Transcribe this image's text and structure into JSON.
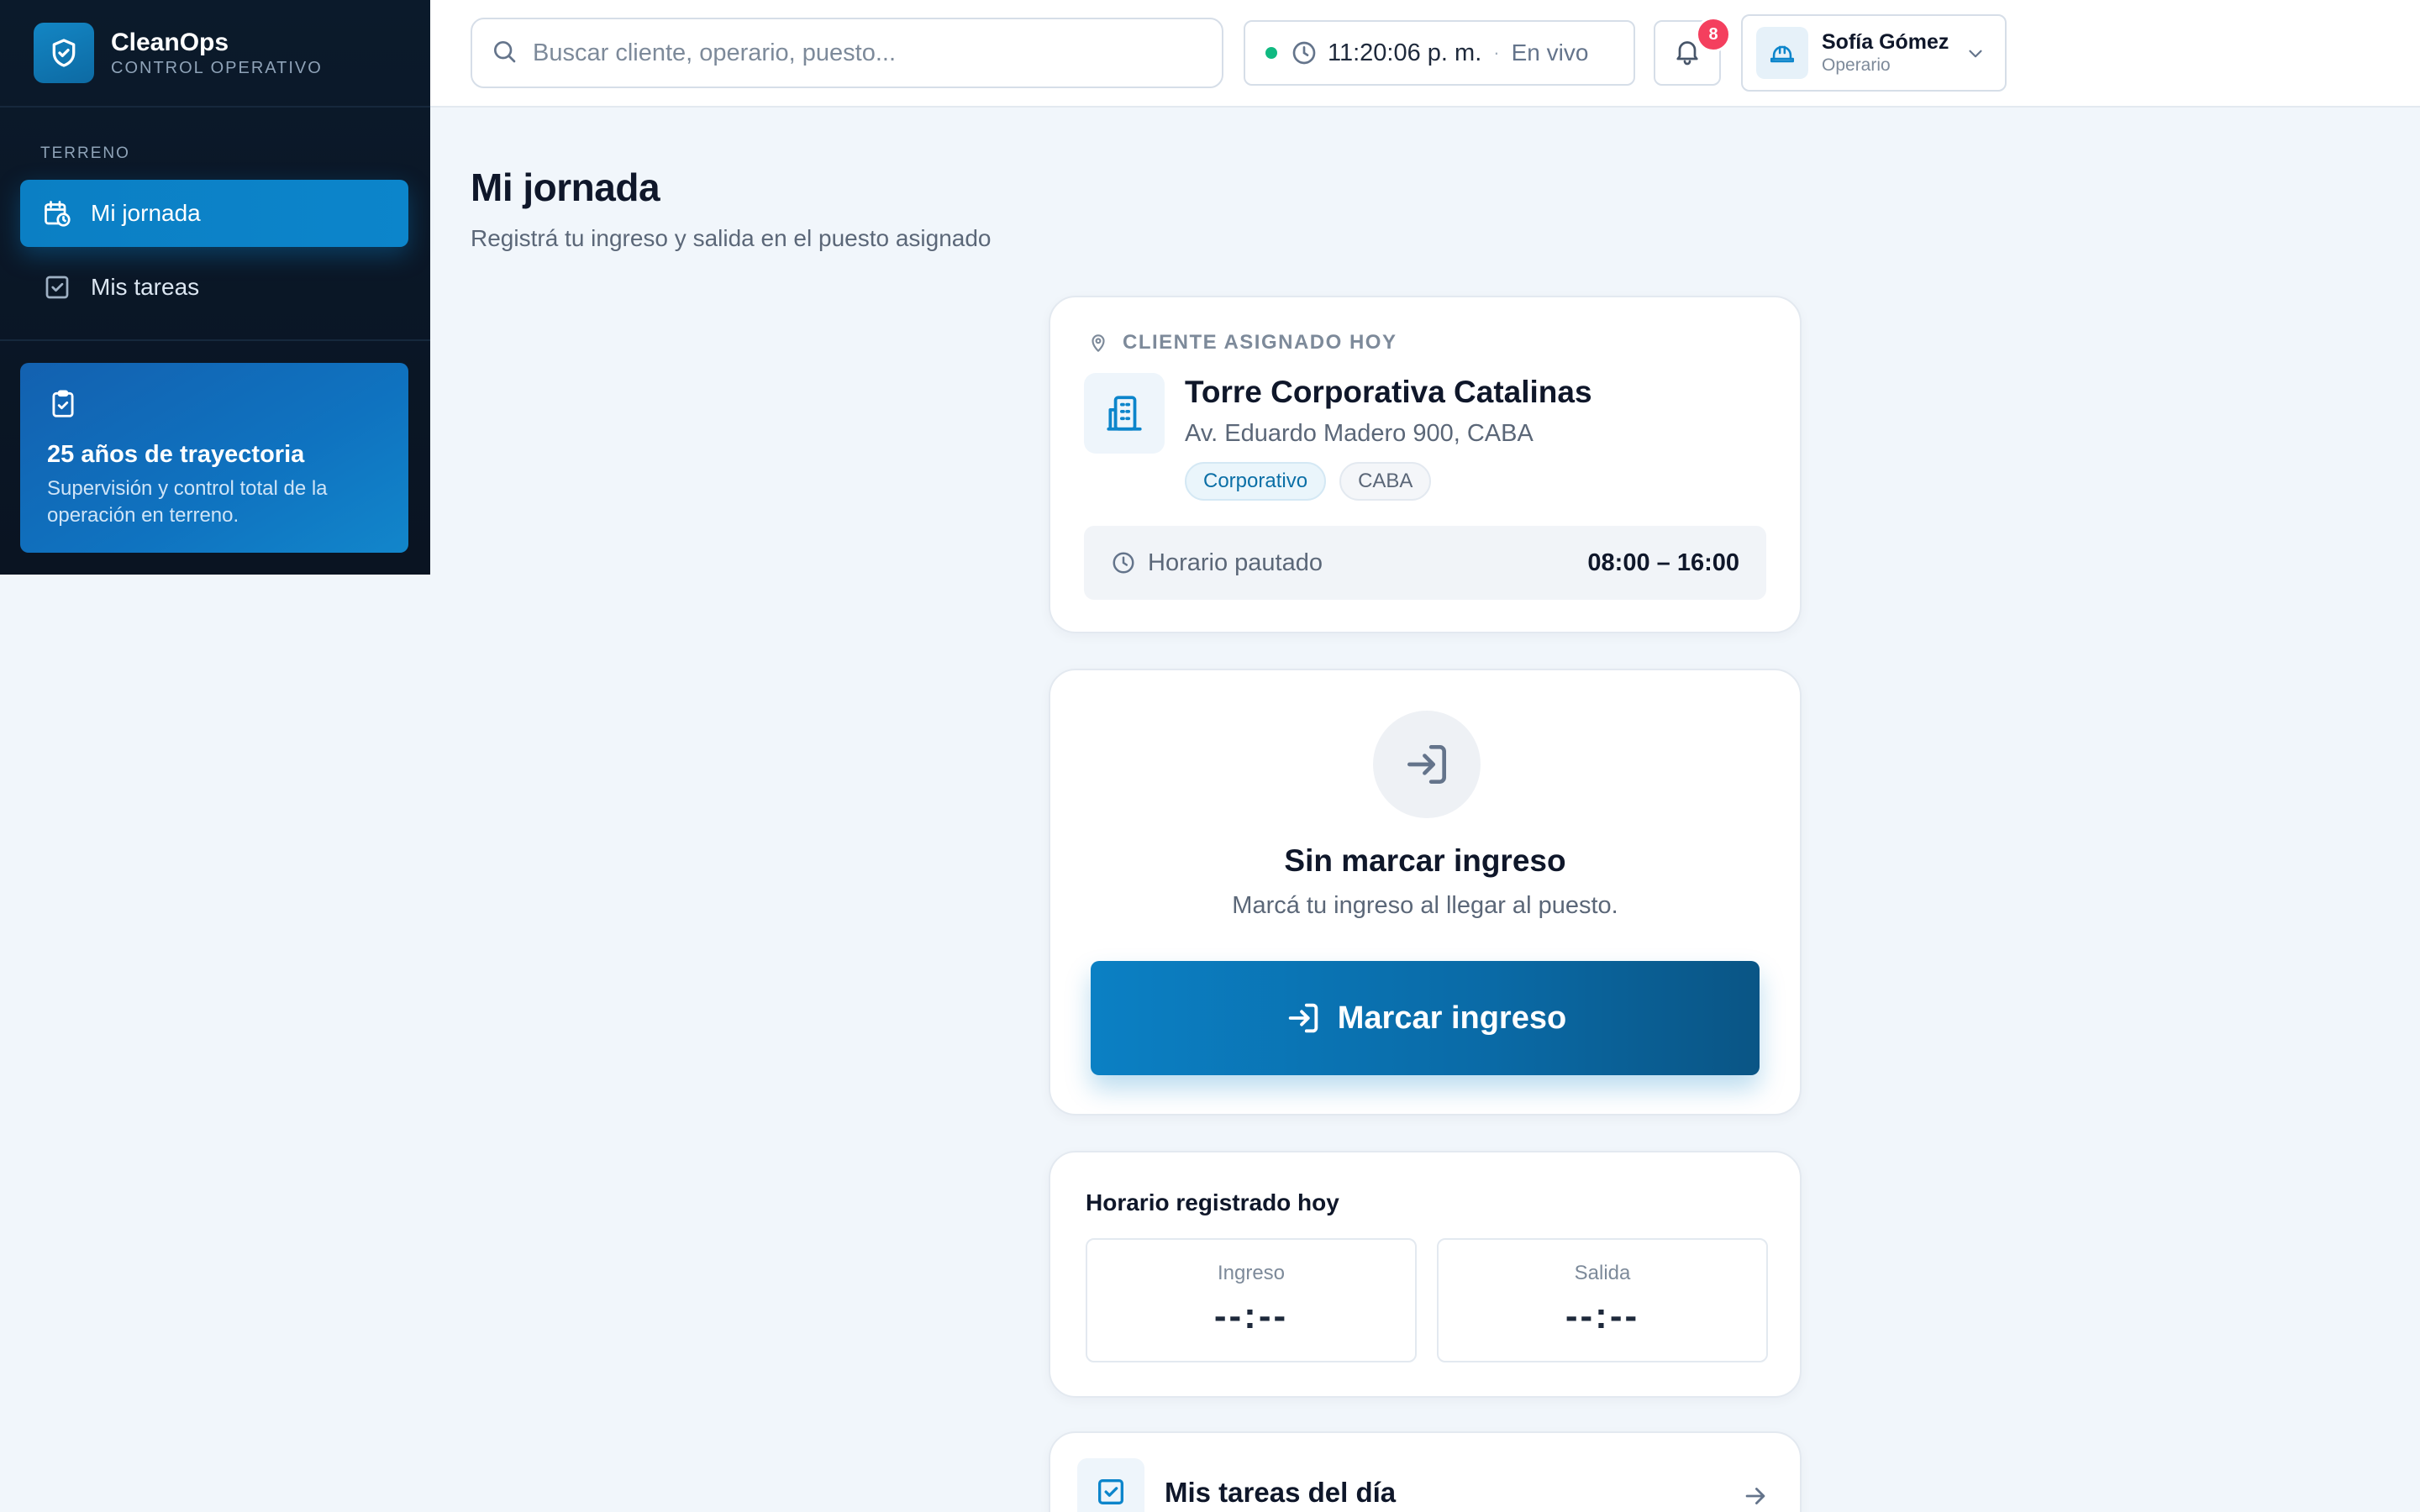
{
  "app": {
    "name": "CleanOps",
    "subtitle": "CONTROL OPERATIVO"
  },
  "sidebar": {
    "section_label": "TERRENO",
    "items": [
      {
        "label": "Mi jornada",
        "icon": "calendar-clock-icon",
        "active": true
      },
      {
        "label": "Mis tareas",
        "icon": "checkbox-icon",
        "active": false
      }
    ],
    "promo": {
      "icon": "clipboard-check-icon",
      "title": "25 años de trayectoria",
      "text": "Supervisión y control total de la operación en terreno."
    }
  },
  "header": {
    "search_placeholder": "Buscar cliente, operario, puesto...",
    "clock_time": "11:20:06 p. m.",
    "clock_separator": "·",
    "live_label": "En vivo",
    "notifications_count": "8",
    "user_name": "Sofía Gómez",
    "user_role": "Operario"
  },
  "main": {
    "title": "Mi jornada",
    "subtitle": "Registrá tu ingreso y salida en el puesto asignado",
    "client_card": {
      "label": "CLIENTE ASIGNADO HOY",
      "name": "Torre Corporativa Catalinas",
      "address": "Av. Eduardo Madero 900, CABA",
      "tags": [
        "Corporativo",
        "CABA"
      ],
      "schedule_label": "Horario pautado",
      "schedule_value": "08:00 – 16:00"
    },
    "checkin_card": {
      "status_title": "Sin marcar ingreso",
      "status_text": "Marcá tu ingreso al llegar al puesto.",
      "button_label": "Marcar ingreso"
    },
    "hours_card": {
      "title": "Horario registrado hoy",
      "in_label": "Ingreso",
      "in_value": "--:--",
      "out_label": "Salida",
      "out_value": "--:--"
    },
    "tasks_card": {
      "title": "Mis tareas del día"
    }
  },
  "colors": {
    "accent": "#0c85cb",
    "sidebar_bg": "#0b1a2b",
    "live_dot": "#10b981",
    "badge": "#f43f5e"
  }
}
